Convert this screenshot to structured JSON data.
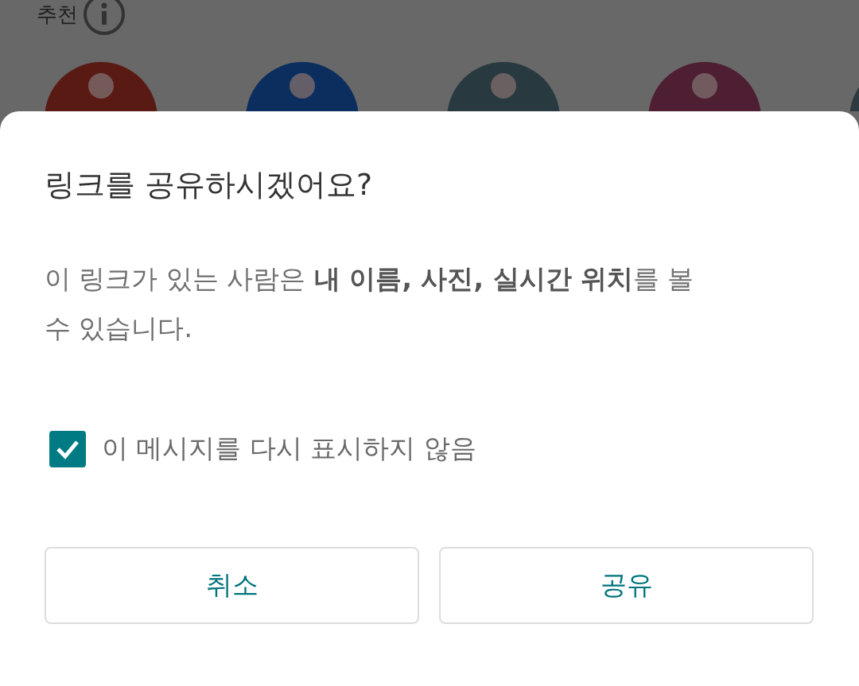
{
  "background": {
    "section_title": "추천",
    "avatars": [
      {
        "color": "#5a1a14"
      },
      {
        "color": "#0b2e5e"
      },
      {
        "color": "#28393f"
      },
      {
        "color": "#4e1f33"
      },
      {
        "color": "#2e3a40"
      }
    ]
  },
  "dialog": {
    "title": "링크를 공유하시겠어요?",
    "message": "이 링크가 있는 사람은 **내 이름, 사진, 실시간 위치**를 볼 수 있습니다.",
    "checkbox": {
      "label": "이 메시지를 다시 표시하지 않음",
      "checked": true
    },
    "buttons": [
      "취소",
      "공유"
    ]
  }
}
